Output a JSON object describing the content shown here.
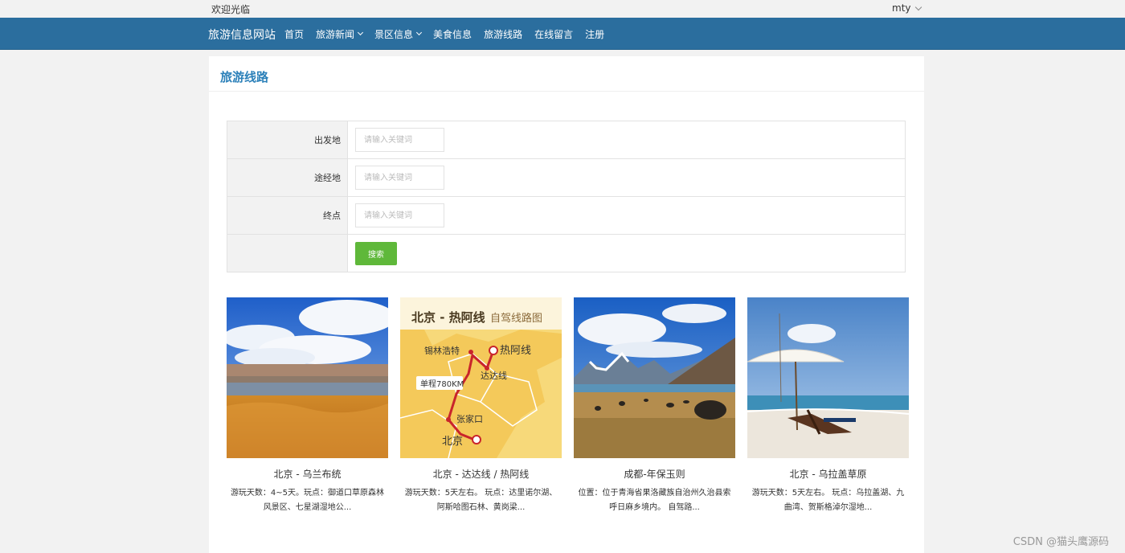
{
  "topbar": {
    "welcome": "欢迎光临",
    "user": "mty"
  },
  "navbar": {
    "brand": "旅游信息网站",
    "items": [
      {
        "label": "首页"
      },
      {
        "label": "旅游新闻"
      },
      {
        "label": "景区信息"
      },
      {
        "label": "美食信息"
      },
      {
        "label": "旅游线路"
      },
      {
        "label": "在线留言"
      },
      {
        "label": "注册"
      }
    ]
  },
  "page_title": "旅游线路",
  "search": {
    "fields": [
      {
        "label": "出发地",
        "placeholder": "请输入关键词"
      },
      {
        "label": "途经地",
        "placeholder": "请输入关键词"
      },
      {
        "label": "终点",
        "placeholder": "请输入关键词"
      }
    ],
    "button": "搜索"
  },
  "routes": [
    {
      "title": "北京 - 乌兰布统",
      "desc": "游玩天数：4~5天。玩点：御道口草原森林风景区、七星湖湿地公..."
    },
    {
      "title": "北京 - 达达线 / 热阿线",
      "desc": "游玩天数：5天左右。 玩点：达里诺尔湖、阿斯哈图石林、黄岗梁...",
      "map": {
        "title": "北京 - 热阿线",
        "subtitle": "自驾线路图",
        "labels": [
          "锡林浩特",
          "热阿线",
          "达达线",
          "单程780KM",
          "张家口",
          "北京"
        ]
      }
    },
    {
      "title": "成都-年保玉则",
      "desc": "位置：位于青海省果洛藏族自治州久治县索呼日麻乡境内。 自驾路..."
    },
    {
      "title": "北京 - 乌拉盖草原",
      "desc": "游玩天数：5天左右。 玩点：乌拉盖湖、九曲湾、贺斯格淖尔湿地..."
    }
  ],
  "watermark": "CSDN @猫头鹰源码"
}
